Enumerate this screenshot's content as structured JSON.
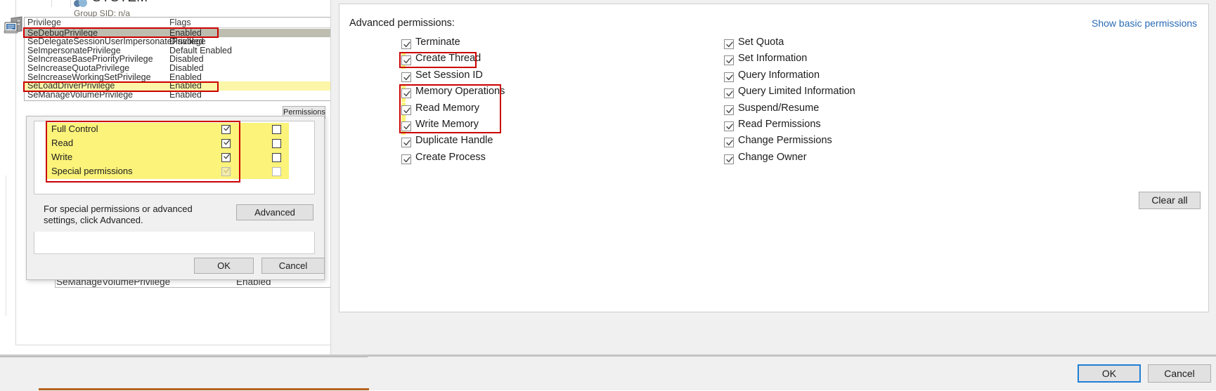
{
  "left_window": {
    "system_label": "SYSTEM",
    "group_sid": "Group SID:  n/a",
    "privilege_table": {
      "headers": [
        "Privilege",
        "Flags"
      ],
      "rows": [
        {
          "name": "SeDebugPrivilege",
          "flag": "Enabled",
          "state": "selected",
          "highlighted": true
        },
        {
          "name": "SeDelegateSessionUserImpersonatePrivilege",
          "flag": "Disabled",
          "state": "normal",
          "highlighted": false
        },
        {
          "name": "SeImpersonatePrivilege",
          "flag": "Default Enabled",
          "state": "normal",
          "highlighted": false
        },
        {
          "name": "SeIncreaseBasePriorityPrivilege",
          "flag": "Disabled",
          "state": "normal",
          "highlighted": false
        },
        {
          "name": "SeIncreaseQuotaPrivilege",
          "flag": "Disabled",
          "state": "normal",
          "highlighted": false
        },
        {
          "name": "SeIncreaseWorkingSetPrivilege",
          "flag": "Enabled",
          "state": "normal",
          "highlighted": false
        },
        {
          "name": "SeLoadDriverPrivilege",
          "flag": "Enabled",
          "state": "normal",
          "highlighted": true
        },
        {
          "name": "SeManageVolumePrivilege",
          "flag": "Enabled",
          "state": "normal",
          "highlighted": false
        }
      ]
    },
    "permissions_button": "Permissions",
    "background_row": {
      "name": "SeManageVolumePrivilege",
      "flag": "Enabled"
    },
    "scrollbar": {
      "up_arrow": "⌃",
      "down_arrow": "⌄"
    }
  },
  "security_dialog": {
    "permission_rows": [
      {
        "label": "Full Control",
        "allow": true,
        "deny": false,
        "disabled": false
      },
      {
        "label": "Read",
        "allow": true,
        "deny": false,
        "disabled": false
      },
      {
        "label": "Write",
        "allow": true,
        "deny": false,
        "disabled": false
      },
      {
        "label": "Special permissions",
        "allow": true,
        "deny": false,
        "disabled": true
      }
    ],
    "hint_text": "For special permissions or advanced settings, click Advanced.",
    "advanced_button": "Advanced",
    "ok_button": "OK",
    "cancel_button": "Cancel"
  },
  "advanced_panel": {
    "title": "Advanced permissions:",
    "show_basic_link": "Show basic permissions",
    "clear_all_button": "Clear all",
    "ok_button": "OK",
    "cancel_button": "Cancel",
    "left_column": [
      {
        "label": "Terminate",
        "checked": true,
        "highlighted": false
      },
      {
        "label": "Create Thread",
        "checked": true,
        "highlighted": true
      },
      {
        "label": "Set Session ID",
        "checked": true,
        "highlighted": false
      },
      {
        "label": "Memory Operations",
        "checked": true,
        "highlighted": true
      },
      {
        "label": "Read Memory",
        "checked": true,
        "highlighted": true
      },
      {
        "label": "Write Memory",
        "checked": true,
        "highlighted": true
      },
      {
        "label": "Duplicate Handle",
        "checked": true,
        "highlighted": false
      },
      {
        "label": "Create Process",
        "checked": true,
        "highlighted": false
      }
    ],
    "right_column": [
      {
        "label": "Set Quota",
        "checked": true,
        "highlighted": false
      },
      {
        "label": "Set Information",
        "checked": true,
        "highlighted": false
      },
      {
        "label": "Query Information",
        "checked": true,
        "highlighted": false
      },
      {
        "label": "Query Limited Information",
        "checked": true,
        "highlighted": false
      },
      {
        "label": "Suspend/Resume",
        "checked": true,
        "highlighted": false
      },
      {
        "label": "Read Permissions",
        "checked": true,
        "highlighted": false
      },
      {
        "label": "Change Permissions",
        "checked": true,
        "highlighted": false
      },
      {
        "label": "Change Owner",
        "checked": true,
        "highlighted": false
      }
    ]
  },
  "colors": {
    "annotation_red": "#cc0000",
    "annotation_yellow": "#fbf37a",
    "link_blue": "#2a6bb5",
    "focus_blue": "#1f7fd4"
  }
}
